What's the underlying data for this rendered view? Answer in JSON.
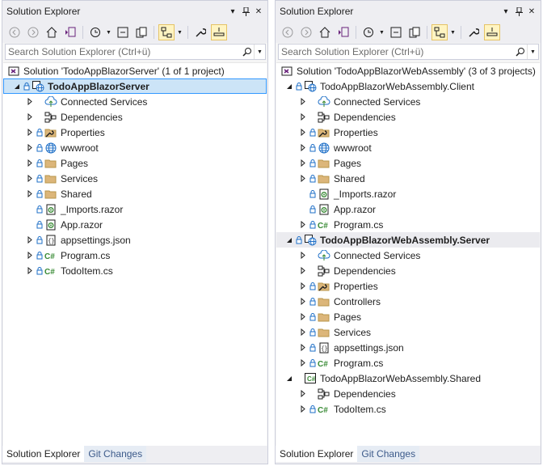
{
  "colors": {
    "accent_blue": "#3399ff",
    "selection_bg": "#cce4f7",
    "active_tool_bg": "#fff4c2",
    "folder": "#dcb67a",
    "csharp_green": "#388a34",
    "globe_blue": "#1e6fc7",
    "vs_purple": "#68217a"
  },
  "left": {
    "title": "Solution Explorer",
    "search_placeholder": "Search Solution Explorer (Ctrl+ü)",
    "tabs": [
      "Solution Explorer",
      "Git Changes"
    ],
    "rows": [
      {
        "label": "Solution 'TodoAppBlazorServer' (1 of 1 project)",
        "icon": "solution-icon",
        "indent": 0,
        "expander": "none",
        "lock": false,
        "bold": false,
        "selected": false
      },
      {
        "label": "TodoAppBlazorServer",
        "icon": "web-project-icon",
        "indent": 1,
        "expander": "expanded",
        "lock": true,
        "bold": true,
        "selected": true
      },
      {
        "label": "Connected Services",
        "icon": "connected-services-icon",
        "indent": 2,
        "expander": "collapsed",
        "lock": false,
        "bold": false,
        "selected": false
      },
      {
        "label": "Dependencies",
        "icon": "dependencies-icon",
        "indent": 2,
        "expander": "collapsed",
        "lock": false,
        "bold": false,
        "selected": false
      },
      {
        "label": "Properties",
        "icon": "properties-folder-icon",
        "indent": 2,
        "expander": "collapsed",
        "lock": true,
        "bold": false,
        "selected": false
      },
      {
        "label": "wwwroot",
        "icon": "globe-icon",
        "indent": 2,
        "expander": "collapsed",
        "lock": true,
        "bold": false,
        "selected": false
      },
      {
        "label": "Pages",
        "icon": "folder-icon",
        "indent": 2,
        "expander": "collapsed",
        "lock": true,
        "bold": false,
        "selected": false
      },
      {
        "label": "Services",
        "icon": "folder-icon",
        "indent": 2,
        "expander": "collapsed",
        "lock": true,
        "bold": false,
        "selected": false
      },
      {
        "label": "Shared",
        "icon": "folder-icon",
        "indent": 2,
        "expander": "collapsed",
        "lock": true,
        "bold": false,
        "selected": false
      },
      {
        "label": "_Imports.razor",
        "icon": "razor-file-icon",
        "indent": 2,
        "expander": "none",
        "lock": true,
        "bold": false,
        "selected": false
      },
      {
        "label": "App.razor",
        "icon": "razor-file-icon",
        "indent": 2,
        "expander": "none",
        "lock": true,
        "bold": false,
        "selected": false
      },
      {
        "label": "appsettings.json",
        "icon": "json-file-icon",
        "indent": 2,
        "expander": "collapsed",
        "lock": true,
        "bold": false,
        "selected": false
      },
      {
        "label": "Program.cs",
        "icon": "csharp-file-icon",
        "indent": 2,
        "expander": "collapsed",
        "lock": true,
        "bold": false,
        "selected": false
      },
      {
        "label": "TodoItem.cs",
        "icon": "csharp-file-icon",
        "indent": 2,
        "expander": "collapsed",
        "lock": true,
        "bold": false,
        "selected": false
      }
    ]
  },
  "right": {
    "title": "Solution Explorer",
    "search_placeholder": "Search Solution Explorer (Ctrl+ü)",
    "tabs": [
      "Solution Explorer",
      "Git Changes"
    ],
    "rows": [
      {
        "label": "Solution 'TodoAppBlazorWebAssembly' (3 of 3 projects)",
        "icon": "solution-icon",
        "indent": 0,
        "expander": "none",
        "lock": false,
        "bold": false,
        "selected": false
      },
      {
        "label": "TodoAppBlazorWebAssembly.Client",
        "icon": "web-project-icon",
        "indent": 1,
        "expander": "expanded",
        "lock": true,
        "bold": false,
        "selected": false
      },
      {
        "label": "Connected Services",
        "icon": "connected-services-icon",
        "indent": 2,
        "expander": "collapsed",
        "lock": false,
        "bold": false,
        "selected": false
      },
      {
        "label": "Dependencies",
        "icon": "dependencies-icon",
        "indent": 2,
        "expander": "collapsed",
        "lock": false,
        "bold": false,
        "selected": false
      },
      {
        "label": "Properties",
        "icon": "properties-folder-icon",
        "indent": 2,
        "expander": "collapsed",
        "lock": true,
        "bold": false,
        "selected": false
      },
      {
        "label": "wwwroot",
        "icon": "globe-icon",
        "indent": 2,
        "expander": "collapsed",
        "lock": true,
        "bold": false,
        "selected": false
      },
      {
        "label": "Pages",
        "icon": "folder-icon",
        "indent": 2,
        "expander": "collapsed",
        "lock": true,
        "bold": false,
        "selected": false
      },
      {
        "label": "Shared",
        "icon": "folder-icon",
        "indent": 2,
        "expander": "collapsed",
        "lock": true,
        "bold": false,
        "selected": false
      },
      {
        "label": "_Imports.razor",
        "icon": "razor-file-icon",
        "indent": 2,
        "expander": "none",
        "lock": true,
        "bold": false,
        "selected": false
      },
      {
        "label": "App.razor",
        "icon": "razor-file-icon",
        "indent": 2,
        "expander": "none",
        "lock": true,
        "bold": false,
        "selected": false
      },
      {
        "label": "Program.cs",
        "icon": "csharp-file-icon",
        "indent": 2,
        "expander": "collapsed",
        "lock": true,
        "bold": false,
        "selected": false
      },
      {
        "label": "TodoAppBlazorWebAssembly.Server",
        "icon": "web-project-icon",
        "indent": 1,
        "expander": "expanded",
        "lock": true,
        "bold": true,
        "selected": false,
        "hover": true
      },
      {
        "label": "Connected Services",
        "icon": "connected-services-icon",
        "indent": 2,
        "expander": "collapsed",
        "lock": false,
        "bold": false,
        "selected": false
      },
      {
        "label": "Dependencies",
        "icon": "dependencies-icon",
        "indent": 2,
        "expander": "collapsed",
        "lock": false,
        "bold": false,
        "selected": false
      },
      {
        "label": "Properties",
        "icon": "properties-folder-icon",
        "indent": 2,
        "expander": "collapsed",
        "lock": true,
        "bold": false,
        "selected": false
      },
      {
        "label": "Controllers",
        "icon": "folder-icon",
        "indent": 2,
        "expander": "collapsed",
        "lock": true,
        "bold": false,
        "selected": false
      },
      {
        "label": "Pages",
        "icon": "folder-icon",
        "indent": 2,
        "expander": "collapsed",
        "lock": true,
        "bold": false,
        "selected": false
      },
      {
        "label": "Services",
        "icon": "folder-icon",
        "indent": 2,
        "expander": "collapsed",
        "lock": true,
        "bold": false,
        "selected": false
      },
      {
        "label": "appsettings.json",
        "icon": "json-file-icon",
        "indent": 2,
        "expander": "collapsed",
        "lock": true,
        "bold": false,
        "selected": false
      },
      {
        "label": "Program.cs",
        "icon": "csharp-file-icon",
        "indent": 2,
        "expander": "collapsed",
        "lock": true,
        "bold": false,
        "selected": false
      },
      {
        "label": "TodoAppBlazorWebAssembly.Shared",
        "icon": "csharp-project-icon",
        "indent": 1,
        "expander": "expanded",
        "lock": false,
        "bold": false,
        "selected": false
      },
      {
        "label": "Dependencies",
        "icon": "dependencies-icon",
        "indent": 2,
        "expander": "collapsed",
        "lock": false,
        "bold": false,
        "selected": false
      },
      {
        "label": "TodoItem.cs",
        "icon": "csharp-file-icon",
        "indent": 2,
        "expander": "collapsed",
        "lock": true,
        "bold": false,
        "selected": false
      }
    ]
  }
}
